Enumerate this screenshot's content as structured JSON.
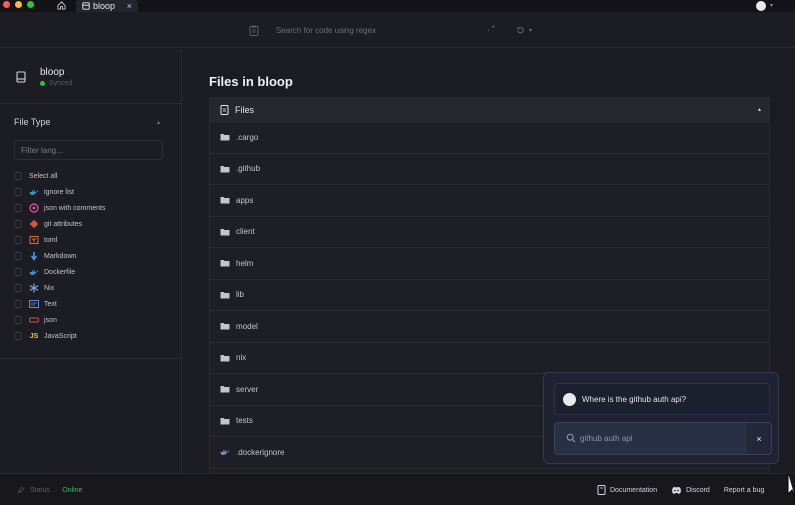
{
  "titlebar": {
    "tab_label": "bloop",
    "tab_close": "×",
    "user_caret": "▾"
  },
  "search": {
    "placeholder": "Search for code using regex",
    "regex_toggle": ".*",
    "history_caret": "▾"
  },
  "sidebar": {
    "repo_name": "bloop",
    "repo_status": "Synced",
    "filetype_title": "File Type",
    "filetype_caret": "▴",
    "filter_placeholder": "Filter lang...",
    "languages": [
      {
        "label": "Select all",
        "icon": "",
        "color": ""
      },
      {
        "label": "ignore list",
        "icon": "docker-whale-icon",
        "color": "#3d8fd6"
      },
      {
        "label": "json with comments",
        "icon": "json-gear-icon",
        "color": "#d44a8c"
      },
      {
        "label": "git attributes",
        "icon": "git-icon",
        "color": "#e05538"
      },
      {
        "label": "toml",
        "icon": "toml-icon",
        "color": "#e0663a"
      },
      {
        "label": "Markdown",
        "icon": "markdown-arrow-icon",
        "color": "#5a8de0"
      },
      {
        "label": "Dockerfile",
        "icon": "docker-whale-icon",
        "color": "#3d8fd6"
      },
      {
        "label": "Nix",
        "icon": "nix-snowflake-icon",
        "color": "#7aa7d9"
      },
      {
        "label": "Text",
        "icon": "text-lines-icon",
        "color": "#5a8de0"
      },
      {
        "label": "json",
        "icon": "json-bracket-icon",
        "color": "#d44a4a"
      },
      {
        "label": "JavaScript",
        "icon": "js-icon",
        "color": "#e8c93a",
        "glyph": "JS"
      }
    ]
  },
  "main": {
    "title": "Files in bloop",
    "files_header": "Files",
    "files_caret": "▴",
    "files": [
      {
        "name": ".cargo",
        "type": "folder"
      },
      {
        "name": ".github",
        "type": "folder"
      },
      {
        "name": "apps",
        "type": "folder"
      },
      {
        "name": "client",
        "type": "folder"
      },
      {
        "name": "helm",
        "type": "folder"
      },
      {
        "name": "lib",
        "type": "folder"
      },
      {
        "name": "model",
        "type": "folder"
      },
      {
        "name": "nix",
        "type": "folder"
      },
      {
        "name": "server",
        "type": "folder"
      },
      {
        "name": "tests",
        "type": "folder"
      },
      {
        "name": ".dockerignore",
        "type": "docker"
      }
    ]
  },
  "chat": {
    "message": "Where is the github auth api?",
    "input_value": "github auth api",
    "clear": "×"
  },
  "status": {
    "label": "Status",
    "separator": "·",
    "state": "Online",
    "documentation": "Documentation",
    "discord": "Discord",
    "report": "Report a bug"
  },
  "colors": {
    "accent_green": "#2fbf4f",
    "background": "#1b1b22",
    "chat_bg": "#1e2233"
  }
}
